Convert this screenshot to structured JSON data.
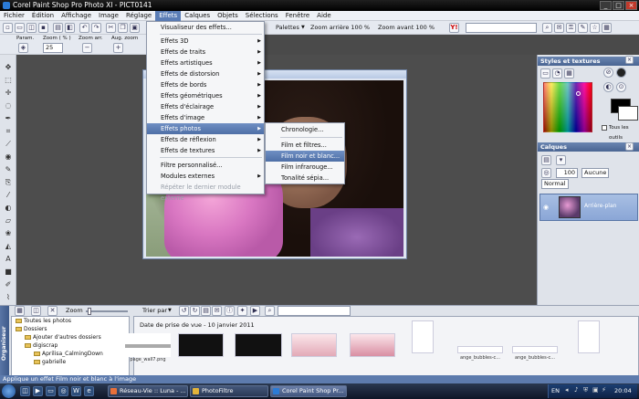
{
  "window": {
    "title": "Corel Paint Shop Pro Photo XI - PICT0141"
  },
  "menubar": [
    "Fichier",
    "Édition",
    "Affichage",
    "Image",
    "Réglage",
    "Effets",
    "Calques",
    "Objets",
    "Sélections",
    "Fenêtre",
    "Aide"
  ],
  "toolbar": {
    "palettes_label": "Palettes",
    "zoom_out_label": "Zoom arrière 100 %",
    "zoom_in_label": "Zoom avant 100 %",
    "params_label": "Param.",
    "zoom_pct_label": "Zoom ( % )",
    "zoom_value": "25",
    "zoom_out_short": "Zoom arr.",
    "zoom_in_short": "Aug. zoom"
  },
  "effects_menu": {
    "items": [
      {
        "label": "Visualiseur des effets...",
        "arrow": false
      },
      {
        "label": "Effets 3D",
        "arrow": true
      },
      {
        "label": "Effets de traits",
        "arrow": true
      },
      {
        "label": "Effets artistiques",
        "arrow": true
      },
      {
        "label": "Effets de distorsion",
        "arrow": true
      },
      {
        "label": "Effets de bords",
        "arrow": true
      },
      {
        "label": "Effets géométriques",
        "arrow": true
      },
      {
        "label": "Effets d'éclairage",
        "arrow": true
      },
      {
        "label": "Effets d'image",
        "arrow": true
      },
      {
        "label": "Effets photos",
        "arrow": true
      },
      {
        "label": "Effets de réflexion",
        "arrow": true
      },
      {
        "label": "Effets de textures",
        "arrow": true
      },
      {
        "label": "Filtre personnalisé...",
        "arrow": false
      },
      {
        "label": "Modules externes",
        "arrow": true
      },
      {
        "label": "Répéter le dernier module externe",
        "arrow": false
      }
    ]
  },
  "photo_submenu": {
    "items": [
      "Chronologie...",
      "Film et filtres...",
      "Film noir et blanc...",
      "Film infrarouge...",
      "Tonalité sépia..."
    ]
  },
  "panels": {
    "styles_title": "Styles et textures",
    "layers_title": "Calques",
    "all_tools_label": "Tous les outils",
    "opacity_value": "100",
    "blend_label": "Aucune",
    "mode_label": "Normal",
    "layer_name": "Arrière-plan"
  },
  "organizer": {
    "side_label": "Organiseur",
    "zoom_label": "Zoom",
    "sort_label": "Trier par",
    "date_header": "Date de prise de vue -  10 janvier 2011",
    "tree": [
      "Toutes les photos",
      "Dossiers",
      "Ajouter d'autres dossiers",
      "digiscrap",
      "Aprilisa_CalmingDown",
      "gabrielle"
    ],
    "thumbs": [
      "page_wall7.png",
      "ange_bubbles-c...",
      "ange_bubbles-c..."
    ]
  },
  "status": {
    "text": "Applique un effet Film noir et blanc à l'image"
  },
  "taskbar": {
    "tasks": [
      "Réseau-Vie :: Luna - ...",
      "PhotoFiltre",
      "Corel Paint Shop Pr..."
    ],
    "lang": "EN",
    "clock": "20:04"
  }
}
